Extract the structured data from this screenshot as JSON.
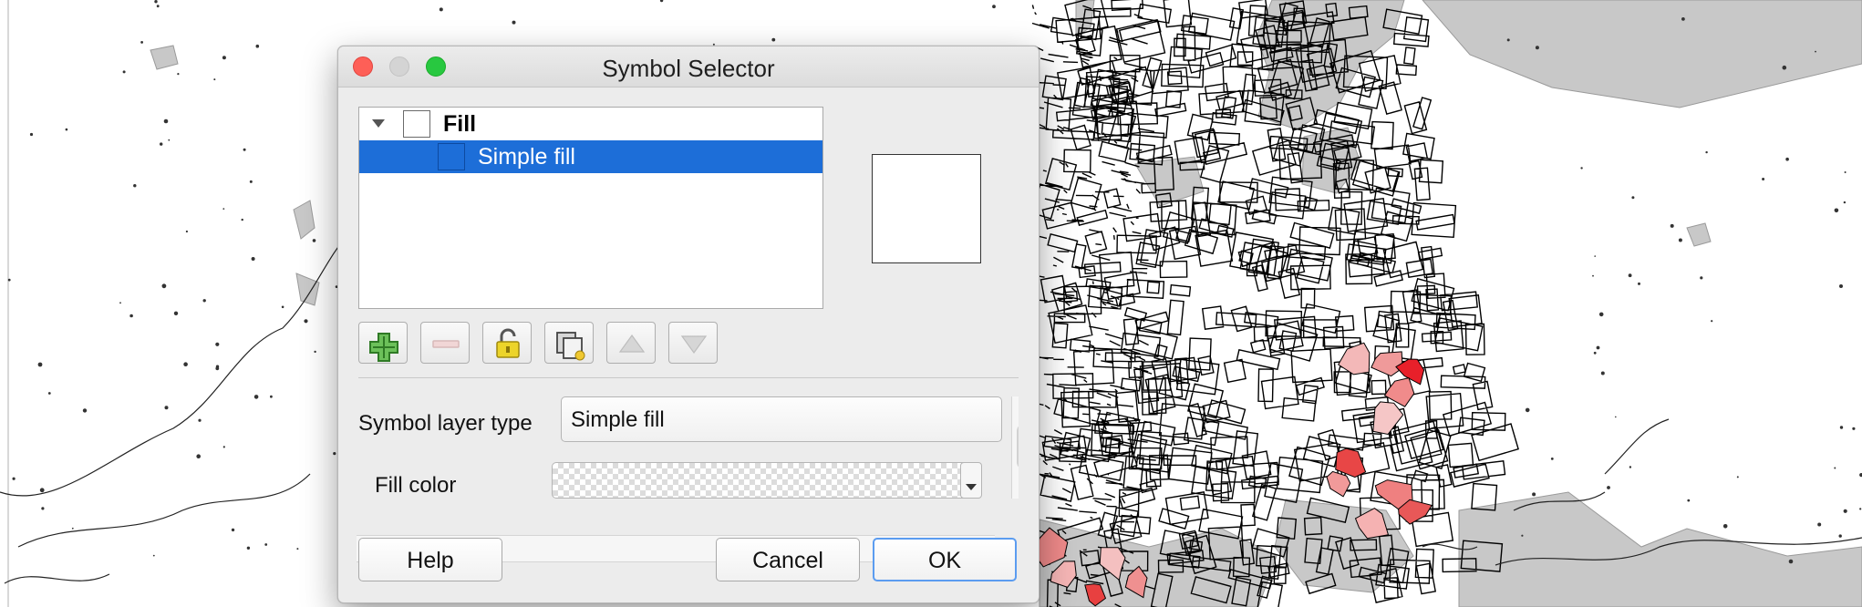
{
  "dialog": {
    "title": "Symbol Selector"
  },
  "tree": {
    "root_label": "Fill",
    "child_label": "Simple fill"
  },
  "toolbar": {
    "buttons": [
      {
        "icon": "add-layer-icon",
        "enabled": true
      },
      {
        "icon": "remove-layer-icon",
        "enabled": false
      },
      {
        "icon": "lock-color-icon",
        "enabled": true
      },
      {
        "icon": "duplicate-layer-icon",
        "enabled": true
      },
      {
        "icon": "move-up-icon",
        "enabled": false
      },
      {
        "icon": "move-down-icon",
        "enabled": false
      }
    ]
  },
  "properties": {
    "symbol_layer_type_label": "Symbol layer type",
    "symbol_layer_type_value": "Simple fill",
    "fill_color_label": "Fill color"
  },
  "buttons": {
    "help": "Help",
    "cancel": "Cancel",
    "ok": "OK"
  },
  "colors": {
    "selection": "#1d6ed8",
    "map_water": "#c8c8c8",
    "map_highlight": "#e8202a"
  }
}
